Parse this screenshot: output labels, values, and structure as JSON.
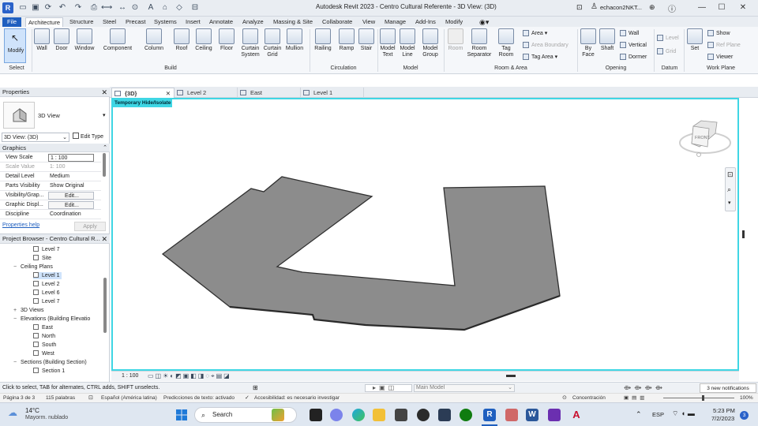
{
  "window": {
    "title": "Autodesk Revit 2023 - Centro Cultural Referente - 3D View: (3D)",
    "user": "echacon2NKT...",
    "minimize": "—",
    "maximize": "☐",
    "close": "✕"
  },
  "menu_tabs": [
    "File",
    "Architecture",
    "Structure",
    "Steel",
    "Precast",
    "Systems",
    "Insert",
    "Annotate",
    "Analyze",
    "Massing & Site",
    "Collaborate",
    "View",
    "Manage",
    "Add-Ins",
    "Modify"
  ],
  "active_tab": "Architecture",
  "ribbon": {
    "modify": "Modify",
    "select_label": "Select",
    "build": {
      "label": "Build",
      "buttons": [
        "Wall",
        "Door",
        "Window",
        "Component",
        "Column",
        "Roof",
        "Ceiling",
        "Floor",
        "Curtain System",
        "Curtain Grid",
        "Mullion"
      ]
    },
    "circulation": {
      "label": "Circulation",
      "buttons": [
        "Railing",
        "Ramp",
        "Stair"
      ]
    },
    "model": {
      "label": "Model",
      "buttons": [
        "Model Text",
        "Model Line",
        "Model Group"
      ]
    },
    "room_area": {
      "label": "Room & Area",
      "buttons": [
        "Room",
        "Room Separator",
        "Tag Room"
      ],
      "small": [
        "Area",
        "Area Boundary",
        "Tag Area"
      ]
    },
    "opening": {
      "label": "Opening",
      "buttons": [
        "By Face",
        "Shaft"
      ],
      "small": [
        "Wall",
        "Vertical",
        "Dormer"
      ]
    },
    "datum": {
      "label": "Datum",
      "small": [
        "Level",
        "Grid"
      ]
    },
    "work_plane": {
      "label": "Work Plane",
      "buttons": [
        "Set"
      ],
      "small": [
        "Show",
        "Ref Plane",
        "Viewer"
      ]
    }
  },
  "properties": {
    "header": "Properties",
    "type_name": "3D View",
    "view_selector": "3D View: (3D)",
    "edit_type": "Edit Type",
    "group": "Graphics",
    "rows": [
      {
        "key": "View Scale",
        "value": "1 : 100"
      },
      {
        "key": "Scale Value",
        "value": "1:  100"
      },
      {
        "key": "Detail Level",
        "value": "Medium"
      },
      {
        "key": "Parts Visibility",
        "value": "Show Original"
      },
      {
        "key": "Visibility/Grap...",
        "value": "Edit..."
      },
      {
        "key": "Graphic Displ...",
        "value": "Edit..."
      },
      {
        "key": "Discipline",
        "value": "Coordination"
      }
    ],
    "help": "Properties help",
    "apply": "Apply"
  },
  "project_browser": {
    "header": "Project Browser - Centro Cultural R...",
    "nodes": [
      {
        "label": "Level 7",
        "type": "leaf"
      },
      {
        "label": "Site",
        "type": "leaf"
      },
      {
        "label": "Ceiling Plans",
        "type": "group"
      },
      {
        "label": "Level 1",
        "type": "leaf"
      },
      {
        "label": "Level 2",
        "type": "leaf"
      },
      {
        "label": "Level 6",
        "type": "leaf"
      },
      {
        "label": "Level 7",
        "type": "leaf"
      },
      {
        "label": "3D Views",
        "type": "group"
      },
      {
        "label": "Elevations (Building Elevatio",
        "type": "group"
      },
      {
        "label": "East",
        "type": "leaf"
      },
      {
        "label": "North",
        "type": "leaf"
      },
      {
        "label": "South",
        "type": "leaf"
      },
      {
        "label": "West",
        "type": "leaf"
      },
      {
        "label": "Sections (Building Section)",
        "type": "group"
      },
      {
        "label": "Section 1",
        "type": "leaf"
      }
    ]
  },
  "view_tabs": [
    {
      "label": "{3D}",
      "active": true
    },
    {
      "label": "Level 2",
      "active": false
    },
    {
      "label": "East",
      "active": false
    },
    {
      "label": "Level 1",
      "active": false
    }
  ],
  "viewport": {
    "badge": "Temporary Hide/Isolate",
    "viewcube_face": "FRONT",
    "scale": "1 : 100"
  },
  "status": {
    "hint": "Click to select, TAB for alternates, CTRL adds, SHIFT unselects.",
    "workset": "Main Model",
    "notifications": "3 new notifications",
    "zoom_pct": "100%",
    "concentration": "Concentración"
  },
  "word_status": {
    "page": "Página 3 de 3",
    "words": "115 palabras",
    "language": "Español (América latina)",
    "predictions": "Predicciones de texto: activado",
    "accessibility": "Accesibilidad: es necesario investigar"
  },
  "taskbar": {
    "weather_temp": "14°C",
    "weather_desc": "Mayorm. nublado",
    "search": "Search",
    "lang": "ESP",
    "time": "5:23 PM",
    "date": "7/2/2023",
    "badge": "3"
  },
  "colors": {
    "accent": "#1f5fbf",
    "isolate": "#3fd6e4",
    "floor": "#8c8c8c"
  }
}
